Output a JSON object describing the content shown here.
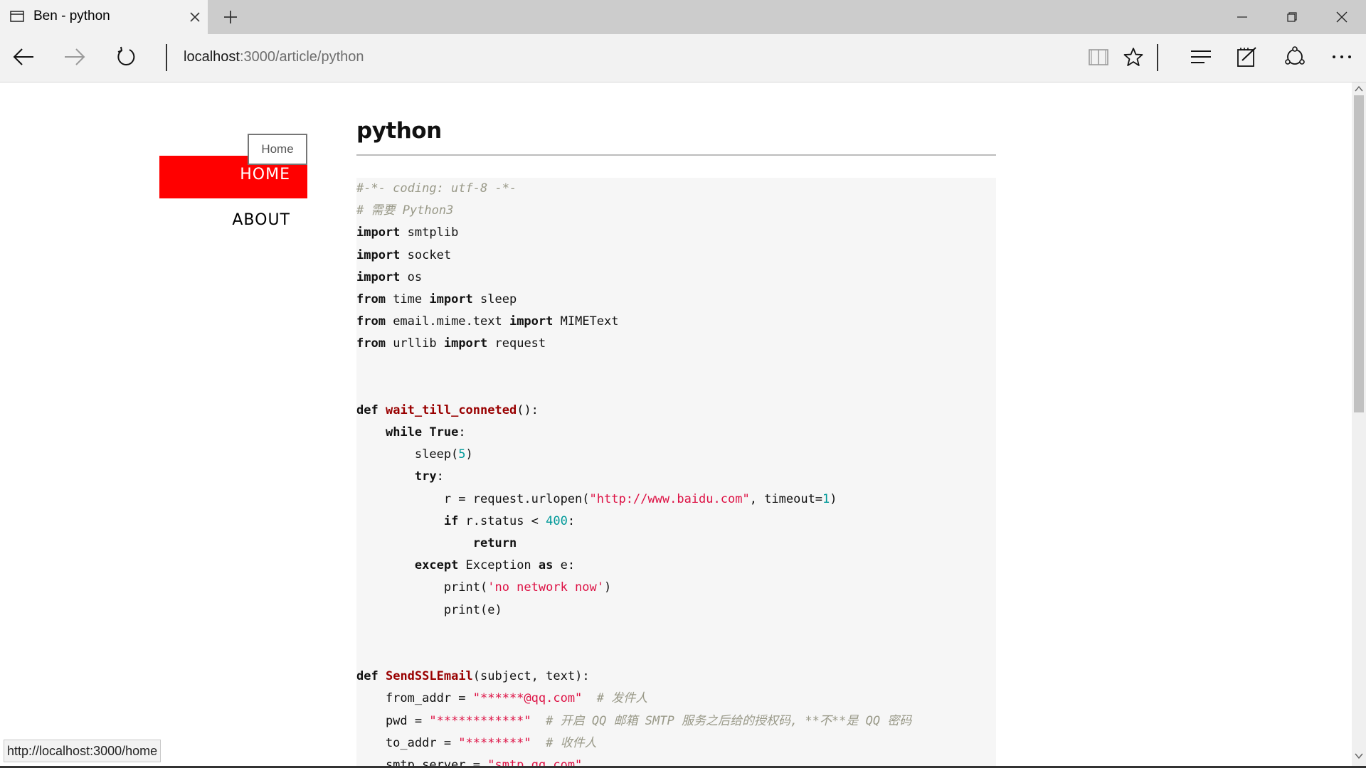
{
  "browser": {
    "tab_title": "Ben - python",
    "url_host": "localhost",
    "url_path": ":3000/article/python",
    "status_url": "http://localhost:3000/home"
  },
  "page": {
    "nav": {
      "home_label": "HOME",
      "about_label": "ABOUT",
      "hover_tooltip": "Home",
      "active_color": "#ff0000"
    },
    "article_title": "python",
    "code_lines": [
      [
        {
          "t": "#-*- coding: utf-8 -*-",
          "c": "cm"
        }
      ],
      [
        {
          "t": "# 需要 Python3",
          "c": "cm"
        }
      ],
      [
        {
          "t": "import",
          "c": "kw"
        },
        {
          "t": " smtplib"
        }
      ],
      [
        {
          "t": "import",
          "c": "kw"
        },
        {
          "t": " socket"
        }
      ],
      [
        {
          "t": "import",
          "c": "kw"
        },
        {
          "t": " os"
        }
      ],
      [
        {
          "t": "from",
          "c": "kw"
        },
        {
          "t": " time "
        },
        {
          "t": "import",
          "c": "kw"
        },
        {
          "t": " sleep"
        }
      ],
      [
        {
          "t": "from",
          "c": "kw"
        },
        {
          "t": " email.mime.text "
        },
        {
          "t": "import",
          "c": "kw"
        },
        {
          "t": " MIMEText"
        }
      ],
      [
        {
          "t": "from",
          "c": "kw"
        },
        {
          "t": " urllib "
        },
        {
          "t": "import",
          "c": "kw"
        },
        {
          "t": " request"
        }
      ],
      [],
      [],
      [
        {
          "t": "def",
          "c": "kw"
        },
        {
          "t": " "
        },
        {
          "t": "wait_till_conneted",
          "c": "fn"
        },
        {
          "t": "():"
        }
      ],
      [
        {
          "t": "    "
        },
        {
          "t": "while",
          "c": "kw"
        },
        {
          "t": " "
        },
        {
          "t": "True",
          "c": "kw"
        },
        {
          "t": ":"
        }
      ],
      [
        {
          "t": "        sleep("
        },
        {
          "t": "5",
          "c": "nm"
        },
        {
          "t": ")"
        }
      ],
      [
        {
          "t": "        "
        },
        {
          "t": "try",
          "c": "kw"
        },
        {
          "t": ":"
        }
      ],
      [
        {
          "t": "            r = request.urlopen("
        },
        {
          "t": "\"http://www.baidu.com\"",
          "c": "st"
        },
        {
          "t": ", timeout="
        },
        {
          "t": "1",
          "c": "nm"
        },
        {
          "t": ")"
        }
      ],
      [
        {
          "t": "            "
        },
        {
          "t": "if",
          "c": "kw"
        },
        {
          "t": " r.status < "
        },
        {
          "t": "400",
          "c": "nm"
        },
        {
          "t": ":"
        }
      ],
      [
        {
          "t": "                "
        },
        {
          "t": "return",
          "c": "kw"
        }
      ],
      [
        {
          "t": "        "
        },
        {
          "t": "except",
          "c": "kw"
        },
        {
          "t": " Exception "
        },
        {
          "t": "as",
          "c": "kw"
        },
        {
          "t": " e:"
        }
      ],
      [
        {
          "t": "            print("
        },
        {
          "t": "'no network now'",
          "c": "st"
        },
        {
          "t": ")"
        }
      ],
      [
        {
          "t": "            print(e)"
        }
      ],
      [],
      [],
      [
        {
          "t": "def",
          "c": "kw"
        },
        {
          "t": " "
        },
        {
          "t": "SendSSLEmail",
          "c": "fn"
        },
        {
          "t": "(subject, text):"
        }
      ],
      [
        {
          "t": "    from_addr = "
        },
        {
          "t": "\"******@qq.com\"",
          "c": "st"
        },
        {
          "t": "  "
        },
        {
          "t": "# 发件人",
          "c": "cm"
        }
      ],
      [
        {
          "t": "    pwd = "
        },
        {
          "t": "\"************\"",
          "c": "st"
        },
        {
          "t": "  "
        },
        {
          "t": "# 开启 QQ 邮箱 SMTP 服务之后给的授权码, **不**是 QQ 密码",
          "c": "cm"
        }
      ],
      [
        {
          "t": "    to_addr = "
        },
        {
          "t": "\"********\"",
          "c": "st"
        },
        {
          "t": "  "
        },
        {
          "t": "# 收件人",
          "c": "cm"
        }
      ],
      [
        {
          "t": "    smtp_server = "
        },
        {
          "t": "\"smtp.qq.com\"",
          "c": "st"
        }
      ]
    ]
  }
}
